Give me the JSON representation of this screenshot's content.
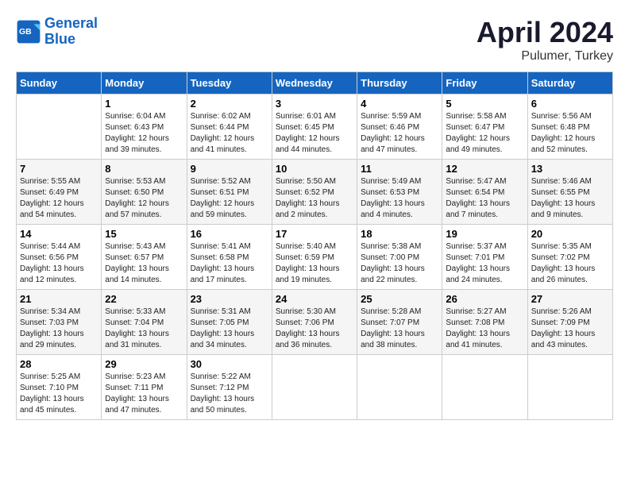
{
  "header": {
    "logo_line1": "General",
    "logo_line2": "Blue",
    "month": "April 2024",
    "location": "Pulumer, Turkey"
  },
  "weekdays": [
    "Sunday",
    "Monday",
    "Tuesday",
    "Wednesday",
    "Thursday",
    "Friday",
    "Saturday"
  ],
  "weeks": [
    [
      {
        "day": "",
        "info": ""
      },
      {
        "day": "1",
        "info": "Sunrise: 6:04 AM\nSunset: 6:43 PM\nDaylight: 12 hours\nand 39 minutes."
      },
      {
        "day": "2",
        "info": "Sunrise: 6:02 AM\nSunset: 6:44 PM\nDaylight: 12 hours\nand 41 minutes."
      },
      {
        "day": "3",
        "info": "Sunrise: 6:01 AM\nSunset: 6:45 PM\nDaylight: 12 hours\nand 44 minutes."
      },
      {
        "day": "4",
        "info": "Sunrise: 5:59 AM\nSunset: 6:46 PM\nDaylight: 12 hours\nand 47 minutes."
      },
      {
        "day": "5",
        "info": "Sunrise: 5:58 AM\nSunset: 6:47 PM\nDaylight: 12 hours\nand 49 minutes."
      },
      {
        "day": "6",
        "info": "Sunrise: 5:56 AM\nSunset: 6:48 PM\nDaylight: 12 hours\nand 52 minutes."
      }
    ],
    [
      {
        "day": "7",
        "info": "Sunrise: 5:55 AM\nSunset: 6:49 PM\nDaylight: 12 hours\nand 54 minutes."
      },
      {
        "day": "8",
        "info": "Sunrise: 5:53 AM\nSunset: 6:50 PM\nDaylight: 12 hours\nand 57 minutes."
      },
      {
        "day": "9",
        "info": "Sunrise: 5:52 AM\nSunset: 6:51 PM\nDaylight: 12 hours\nand 59 minutes."
      },
      {
        "day": "10",
        "info": "Sunrise: 5:50 AM\nSunset: 6:52 PM\nDaylight: 13 hours\nand 2 minutes."
      },
      {
        "day": "11",
        "info": "Sunrise: 5:49 AM\nSunset: 6:53 PM\nDaylight: 13 hours\nand 4 minutes."
      },
      {
        "day": "12",
        "info": "Sunrise: 5:47 AM\nSunset: 6:54 PM\nDaylight: 13 hours\nand 7 minutes."
      },
      {
        "day": "13",
        "info": "Sunrise: 5:46 AM\nSunset: 6:55 PM\nDaylight: 13 hours\nand 9 minutes."
      }
    ],
    [
      {
        "day": "14",
        "info": "Sunrise: 5:44 AM\nSunset: 6:56 PM\nDaylight: 13 hours\nand 12 minutes."
      },
      {
        "day": "15",
        "info": "Sunrise: 5:43 AM\nSunset: 6:57 PM\nDaylight: 13 hours\nand 14 minutes."
      },
      {
        "day": "16",
        "info": "Sunrise: 5:41 AM\nSunset: 6:58 PM\nDaylight: 13 hours\nand 17 minutes."
      },
      {
        "day": "17",
        "info": "Sunrise: 5:40 AM\nSunset: 6:59 PM\nDaylight: 13 hours\nand 19 minutes."
      },
      {
        "day": "18",
        "info": "Sunrise: 5:38 AM\nSunset: 7:00 PM\nDaylight: 13 hours\nand 22 minutes."
      },
      {
        "day": "19",
        "info": "Sunrise: 5:37 AM\nSunset: 7:01 PM\nDaylight: 13 hours\nand 24 minutes."
      },
      {
        "day": "20",
        "info": "Sunrise: 5:35 AM\nSunset: 7:02 PM\nDaylight: 13 hours\nand 26 minutes."
      }
    ],
    [
      {
        "day": "21",
        "info": "Sunrise: 5:34 AM\nSunset: 7:03 PM\nDaylight: 13 hours\nand 29 minutes."
      },
      {
        "day": "22",
        "info": "Sunrise: 5:33 AM\nSunset: 7:04 PM\nDaylight: 13 hours\nand 31 minutes."
      },
      {
        "day": "23",
        "info": "Sunrise: 5:31 AM\nSunset: 7:05 PM\nDaylight: 13 hours\nand 34 minutes."
      },
      {
        "day": "24",
        "info": "Sunrise: 5:30 AM\nSunset: 7:06 PM\nDaylight: 13 hours\nand 36 minutes."
      },
      {
        "day": "25",
        "info": "Sunrise: 5:28 AM\nSunset: 7:07 PM\nDaylight: 13 hours\nand 38 minutes."
      },
      {
        "day": "26",
        "info": "Sunrise: 5:27 AM\nSunset: 7:08 PM\nDaylight: 13 hours\nand 41 minutes."
      },
      {
        "day": "27",
        "info": "Sunrise: 5:26 AM\nSunset: 7:09 PM\nDaylight: 13 hours\nand 43 minutes."
      }
    ],
    [
      {
        "day": "28",
        "info": "Sunrise: 5:25 AM\nSunset: 7:10 PM\nDaylight: 13 hours\nand 45 minutes."
      },
      {
        "day": "29",
        "info": "Sunrise: 5:23 AM\nSunset: 7:11 PM\nDaylight: 13 hours\nand 47 minutes."
      },
      {
        "day": "30",
        "info": "Sunrise: 5:22 AM\nSunset: 7:12 PM\nDaylight: 13 hours\nand 50 minutes."
      },
      {
        "day": "",
        "info": ""
      },
      {
        "day": "",
        "info": ""
      },
      {
        "day": "",
        "info": ""
      },
      {
        "day": "",
        "info": ""
      }
    ]
  ]
}
